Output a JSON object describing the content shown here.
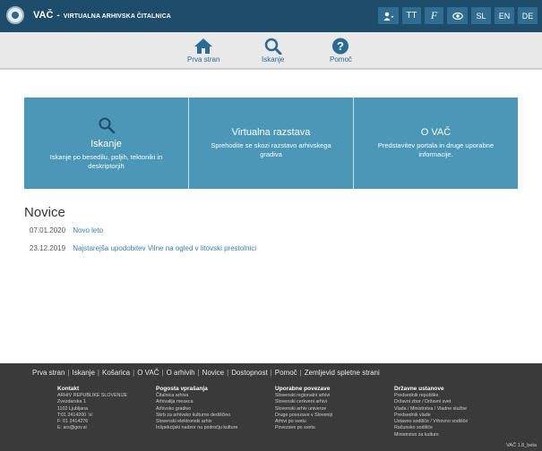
{
  "header": {
    "brand_short": "VAČ",
    "brand_sep": "-",
    "brand_full": "VIRTUALNA ARHIVSKA ČITALNICA",
    "buttons": {
      "user": "▲",
      "font": "TT",
      "cursive": "F",
      "contrast": "◎",
      "lang_sl": "SL",
      "lang_en": "EN",
      "lang_de": "DE"
    }
  },
  "nav": {
    "home": "Prva stran",
    "search": "Iskanje",
    "help": "Pomoč"
  },
  "tiles": [
    {
      "title": "Iskanje",
      "desc": "Iskanje po besedilu, poljih, tektoniki in deskriptorjih"
    },
    {
      "title": "Virtualna razstava",
      "desc": "Sprehodite se skozi razstavo arhivskega gradiva"
    },
    {
      "title": "O VAČ",
      "desc": "Predstavitev portala in druge uporabne informacije."
    }
  ],
  "news": {
    "heading": "Novice",
    "items": [
      {
        "date": "07.01.2020",
        "title": "Novo leto"
      },
      {
        "date": "23.12.2019",
        "title": "Najstarejša upodobitev Vilne na ogled v litovski prestolnici"
      }
    ]
  },
  "footer": {
    "links": [
      "Prva stran",
      "Iskanje",
      "Košarica",
      "O VAČ",
      "O arhivih",
      "Novice",
      "Dostopnost",
      "Pomoč",
      "Zemljevid spletne strani"
    ],
    "contact": {
      "heading": "Kontakt",
      "lines": [
        "ARHIV REPUBLIKE SLOVENIJE",
        "Zvezdarska 1",
        "1102 Ljubljana",
        "T:01 2414200 ☏",
        "F: 01 2414276",
        "E: ars@gov.si"
      ]
    },
    "faq": {
      "heading": "Pogosta vprašanja",
      "lines": [
        "Čitalnica arhiva",
        "Arhivalija meseca",
        "Arhivsko gradivo",
        "Skrb za arhivsko kulturno dediščino",
        "Slovenski elektronski arhiv",
        "Inšpekcijski nadzor na področju kulture"
      ]
    },
    "useful": {
      "heading": "Uporabne povezave",
      "lines": [
        "Slovenski regionalni arhivi",
        "Slovenski cerkveni arhivi",
        "Slovenski arhiv univerze",
        "Druge povezave v Sloveniji",
        "Arhivi po svetu",
        "Povezave po svetu"
      ]
    },
    "institutions": {
      "heading": "Državne ustanove",
      "lines": [
        "Predsednik republike",
        "Državni zbor / Državni svet",
        "Vlada / Ministrstva / Vladne službe",
        "Predsednik vlade",
        "Ustavno sodišče / Vrhovno sodišče",
        "Računsko sodišče",
        "Ministrstvo za kulturo"
      ]
    },
    "version": "VAČ 1.8_beta"
  }
}
